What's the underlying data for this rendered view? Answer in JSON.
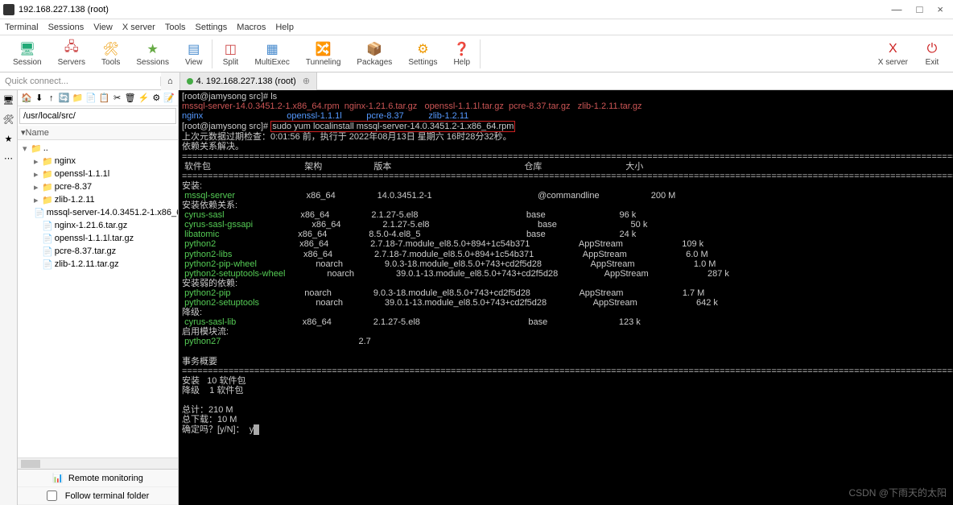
{
  "window": {
    "title": "192.168.227.138 (root)"
  },
  "wincontrols": {
    "min": "—",
    "max": "□",
    "close": "×"
  },
  "menus": [
    "Terminal",
    "Sessions",
    "View",
    "X server",
    "Tools",
    "Settings",
    "Macros",
    "Help"
  ],
  "tools": [
    {
      "icon": "🖥",
      "label": "Session",
      "color": "#2a7"
    },
    {
      "icon": "🖧",
      "label": "Servers",
      "color": "#c44"
    },
    {
      "icon": "🛠",
      "label": "Tools",
      "color": "#e90"
    },
    {
      "icon": "★",
      "label": "Sessions",
      "color": "#6a4"
    },
    {
      "icon": "▤",
      "label": "View",
      "color": "#48c"
    },
    {
      "icon": "◫",
      "label": "Split",
      "color": "#c44"
    },
    {
      "icon": "▦",
      "label": "MultiExec",
      "color": "#48c"
    },
    {
      "icon": "🔀",
      "label": "Tunneling",
      "color": "#e90"
    },
    {
      "icon": "📦",
      "label": "Packages",
      "color": "#48c"
    },
    {
      "icon": "⚙",
      "label": "Settings",
      "color": "#e90"
    },
    {
      "icon": "❓",
      "label": "Help",
      "color": "#48c"
    }
  ],
  "rtools": [
    {
      "icon": "X",
      "label": "X server",
      "color": "#c22"
    },
    {
      "icon": "⏻",
      "label": "Exit",
      "color": "#c22"
    }
  ],
  "quickconnect": "Quick connect...",
  "tabs": [
    {
      "icon": "⌂",
      "label": "",
      "active": false
    },
    {
      "icon": "●",
      "label": "4. 192.168.227.138 (root)",
      "active": true
    }
  ],
  "sideicons": [
    "🖥",
    "🛠",
    "★",
    "⋯"
  ],
  "lefticons": [
    "🏠",
    "⬇",
    "↑",
    "🔄",
    "📁",
    "📄",
    "📋",
    "✂",
    "🗑",
    "⚡",
    "⚙",
    "📝"
  ],
  "path": "/usr/local/src/",
  "treeheader": "Name",
  "tree": [
    {
      "lvl": 0,
      "exp": "▾",
      "type": "fo",
      "name": ".."
    },
    {
      "lvl": 1,
      "exp": "▸",
      "type": "fo",
      "name": "nginx"
    },
    {
      "lvl": 1,
      "exp": "▸",
      "type": "fo",
      "name": "openssl-1.1.1l"
    },
    {
      "lvl": 1,
      "exp": "▸",
      "type": "fo",
      "name": "pcre-8.37"
    },
    {
      "lvl": 1,
      "exp": "▸",
      "type": "fo",
      "name": "zlib-1.2.11"
    },
    {
      "lvl": 1,
      "exp": "",
      "type": "fi",
      "name": "mssql-server-14.0.3451.2-1.x86_64.rpm"
    },
    {
      "lvl": 1,
      "exp": "",
      "type": "fi",
      "name": "nginx-1.21.6.tar.gz"
    },
    {
      "lvl": 1,
      "exp": "",
      "type": "fi",
      "name": "openssl-1.1.1l.tar.gz"
    },
    {
      "lvl": 1,
      "exp": "",
      "type": "fi",
      "name": "pcre-8.37.tar.gz"
    },
    {
      "lvl": 1,
      "exp": "",
      "type": "fi",
      "name": "zlib-1.2.11.tar.gz"
    }
  ],
  "remote_monitoring": "Remote monitoring",
  "follow_terminal": "Follow terminal folder",
  "term": {
    "prompt1": "[root@jamysong src]# ",
    "ls": "ls",
    "lsout": [
      [
        {
          "c": "r",
          "t": "mssql-server-14.0.3451.2-1.x86_64.rpm"
        },
        {
          "c": "r",
          "t": "  nginx-1.21.6.tar.gz"
        },
        {
          "c": "r",
          "t": "   openssl-1.1.1l.tar.gz"
        },
        {
          "c": "r",
          "t": "  pcre-8.37.tar.gz"
        },
        {
          "c": "r",
          "t": "   zlib-1.2.11.tar.gz"
        }
      ],
      [
        {
          "c": "b",
          "t": "nginx"
        },
        {
          "c": "w",
          "t": "                                  "
        },
        {
          "c": "b",
          "t": "openssl-1.1.1l"
        },
        {
          "c": "w",
          "t": "          "
        },
        {
          "c": "b",
          "t": "pcre-8.37"
        },
        {
          "c": "w",
          "t": "          "
        },
        {
          "c": "b",
          "t": "zlib-1.2.11"
        }
      ]
    ],
    "cmdline": "sudo yum localinstall mssql-server-14.0.3451.2-1.x86_64.rpm",
    "meta1": "上次元数据过期检查：0:01:56 前，执行于 2022年08月13日 星期六 16时28分32秒。",
    "meta2": "依赖关系解决。",
    "sep": "================================================================================================================================================================",
    "hdr": {
      "pkg": " 软件包",
      "arch": "架构",
      "ver": "版本",
      "repo": "仓库",
      "size": "大小"
    },
    "install_hdr": "安装:",
    "rows": [
      {
        "n": "mssql-server",
        "a": "x86_64",
        "v": "14.0.3451.2-1",
        "r": "@commandline",
        "s": "200 M"
      }
    ],
    "dep_hdr": "安装依赖关系:",
    "deps": [
      {
        "n": "cyrus-sasl",
        "a": "x86_64",
        "v": "2.1.27-5.el8",
        "r": "base",
        "s": "96 k"
      },
      {
        "n": "cyrus-sasl-gssapi",
        "a": "x86_64",
        "v": "2.1.27-5.el8",
        "r": "base",
        "s": "50 k"
      },
      {
        "n": "libatomic",
        "a": "x86_64",
        "v": "8.5.0-4.el8_5",
        "r": "base",
        "s": "24 k"
      },
      {
        "n": "python2",
        "a": "x86_64",
        "v": "2.7.18-7.module_el8.5.0+894+1c54b371",
        "r": "AppStream",
        "s": "109 k"
      },
      {
        "n": "python2-libs",
        "a": "x86_64",
        "v": "2.7.18-7.module_el8.5.0+894+1c54b371",
        "r": "AppStream",
        "s": "6.0 M"
      },
      {
        "n": "python2-pip-wheel",
        "a": "noarch",
        "v": "9.0.3-18.module_el8.5.0+743+cd2f5d28",
        "r": "AppStream",
        "s": "1.0 M"
      },
      {
        "n": "python2-setuptools-wheel",
        "a": "noarch",
        "v": "39.0.1-13.module_el8.5.0+743+cd2f5d28",
        "r": "AppStream",
        "s": "287 k"
      }
    ],
    "weak_hdr": "安装弱的依赖:",
    "weaks": [
      {
        "n": "python2-pip",
        "a": "noarch",
        "v": "9.0.3-18.module_el8.5.0+743+cd2f5d28",
        "r": "AppStream",
        "s": "1.7 M"
      },
      {
        "n": "python2-setuptools",
        "a": "noarch",
        "v": "39.0.1-13.module_el8.5.0+743+cd2f5d28",
        "r": "AppStream",
        "s": "642 k"
      }
    ],
    "down_hdr": "降级:",
    "downs": [
      {
        "n": "cyrus-sasl-lib",
        "a": "x86_64",
        "v": "2.1.27-5.el8",
        "r": "base",
        "s": "123 k"
      }
    ],
    "enable_hdr": "启用模块流:",
    "enable": {
      "n": "python27",
      "v": "2.7"
    },
    "summary_hdr": "事务概要",
    "summary1": "安装   10 软件包",
    "summary2": "降级    1 软件包",
    "total": "总计：210 M",
    "download": "总下载：10 M",
    "confirm": "确定吗？[y/N]：  y"
  },
  "watermark": "CSDN @下雨天的太阳"
}
